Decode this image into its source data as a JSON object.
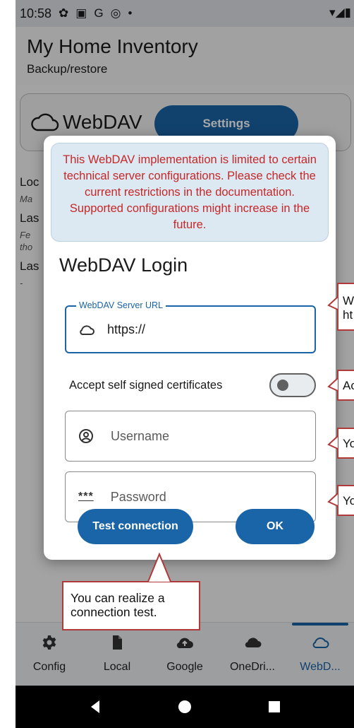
{
  "status_bar": {
    "time": "10:58",
    "icons": [
      "settings-icon",
      "image-icon",
      "google-icon",
      "circle-icon",
      "dot-icon"
    ],
    "right_icons": "▾◢▮"
  },
  "appbar": {
    "title": "My Home Inventory",
    "subtitle": "Backup/restore"
  },
  "webdav_card": {
    "label": "WebDAV",
    "settings_label": "Settings"
  },
  "background_info": {
    "items": [
      {
        "heading": "Loc",
        "sub": "Ma"
      },
      {
        "heading": "Las",
        "sub": "Fe",
        "sub2": "tho"
      },
      {
        "heading": "Las",
        "sub": "-"
      }
    ]
  },
  "dialog": {
    "notice": "This WebDAV implementation is limited to certain technical server configurations. Please check the current restrictions in the documentation. Supported configurations might increase in the future.",
    "title": "WebDAV Login",
    "url_label": "WebDAV Server URL",
    "url_value": "https://",
    "self_signed_label": "Accept self signed certificates",
    "self_signed_on": false,
    "username_placeholder": "Username",
    "password_icon_text": "***",
    "password_placeholder": "Password",
    "test_button": "Test connection",
    "ok_button": "OK"
  },
  "callouts": {
    "url": "W\nht",
    "cert": "Ac",
    "user": "Yo",
    "pass": "Yo",
    "test": "You can realize a connection test."
  },
  "bottom_nav": {
    "items": [
      {
        "label": "Config",
        "icon": "gear-icon"
      },
      {
        "label": "Local",
        "icon": "file-icon"
      },
      {
        "label": "Google",
        "icon": "cloud-upload-icon"
      },
      {
        "label": "OneDri...",
        "icon": "cloud-filled-icon"
      },
      {
        "label": "WebD...",
        "icon": "cloud-outline-icon",
        "active": true
      }
    ]
  },
  "colors": {
    "accent": "#1a64a8",
    "notice_text": "#c62828",
    "notice_bg": "#dce8f2",
    "callout_border": "#b03a3a"
  }
}
